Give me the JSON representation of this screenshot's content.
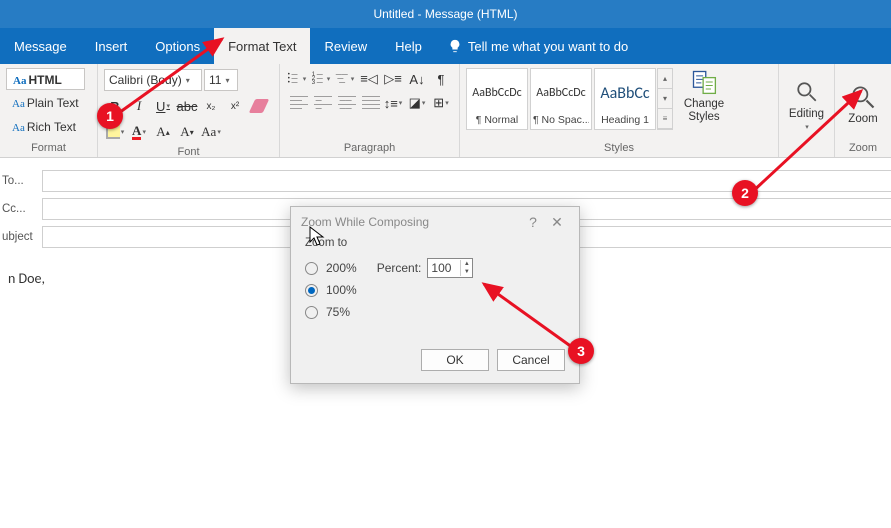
{
  "window": {
    "title": "Untitled - Message (HTML)"
  },
  "menu": {
    "items": [
      "Message",
      "Insert",
      "Options",
      "Format Text",
      "Review",
      "Help"
    ],
    "active_index": 3,
    "tell_me": "Tell me what you want to do"
  },
  "ribbon": {
    "format": {
      "html": "HTML",
      "plain": "Plain Text",
      "rich": "Rich Text",
      "group_label": "Format"
    },
    "font": {
      "font_name": "Calibri (Body)",
      "font_size": "11",
      "group_label": "Font"
    },
    "paragraph": {
      "group_label": "Paragraph"
    },
    "styles": {
      "cards": [
        {
          "preview": "AaBbCcDc",
          "name": "¶ Normal"
        },
        {
          "preview": "AaBbCcDc",
          "name": "¶ No Spac..."
        },
        {
          "preview": "AaBbCc",
          "name": "Heading 1"
        }
      ],
      "change_styles": "Change\nStyles",
      "group_label": "Styles"
    },
    "editing": {
      "label": "Editing"
    },
    "zoom": {
      "label": "Zoom",
      "group_label": "Zoom"
    }
  },
  "compose": {
    "to_label": "To...",
    "cc_label": "Cc...",
    "subject_label": "ubject",
    "body": "n Doe,"
  },
  "dialog": {
    "title": "Zoom While Composing",
    "zoom_to": "Zoom to",
    "options": [
      {
        "label": "200%",
        "checked": false
      },
      {
        "label": "100%",
        "checked": true
      },
      {
        "label": "75%",
        "checked": false
      }
    ],
    "percent_label": "Percent:",
    "percent_value": "100",
    "ok": "OK",
    "cancel": "Cancel"
  },
  "annotations": {
    "badge1": "1",
    "badge2": "2",
    "badge3": "3"
  }
}
